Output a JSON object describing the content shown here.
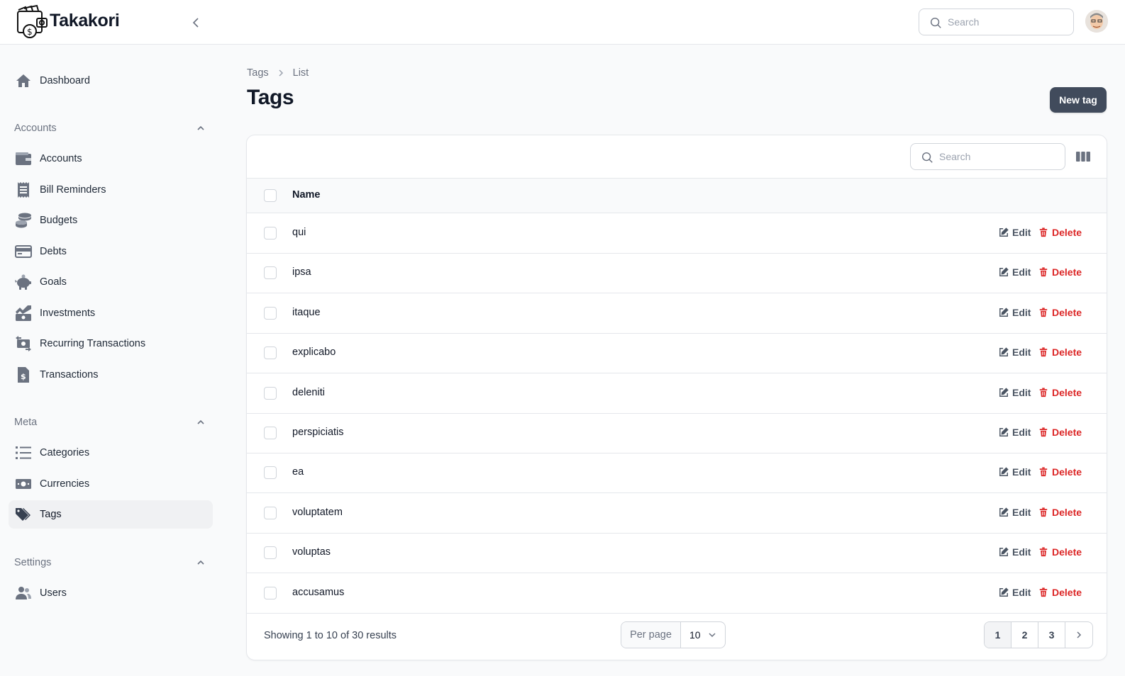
{
  "app": {
    "name": "Takakori"
  },
  "topbar": {
    "search_placeholder": "Search"
  },
  "sidebar": {
    "dashboard": {
      "label": "Dashboard",
      "icon": "home-icon"
    },
    "groups": [
      {
        "label": "Accounts",
        "items": [
          {
            "label": "Accounts",
            "icon": "wallet-icon"
          },
          {
            "label": "Bill Reminders",
            "icon": "receipt-icon"
          },
          {
            "label": "Budgets",
            "icon": "coins-icon"
          },
          {
            "label": "Debts",
            "icon": "credit-card-icon"
          },
          {
            "label": "Goals",
            "icon": "piggy-bank-icon"
          },
          {
            "label": "Investments",
            "icon": "chart-up-icon"
          },
          {
            "label": "Recurring Transactions",
            "icon": "money-refresh-icon"
          },
          {
            "label": "Transactions",
            "icon": "file-dollar-icon"
          }
        ]
      },
      {
        "label": "Meta",
        "items": [
          {
            "label": "Categories",
            "icon": "list-icon"
          },
          {
            "label": "Currencies",
            "icon": "banknote-icon"
          },
          {
            "label": "Tags",
            "icon": "tags-icon",
            "active": true
          }
        ]
      },
      {
        "label": "Settings",
        "items": [
          {
            "label": "Users",
            "icon": "users-icon"
          }
        ]
      }
    ]
  },
  "breadcrumb": [
    "Tags",
    "List"
  ],
  "page": {
    "title": "Tags",
    "new_button": "New tag"
  },
  "table": {
    "search_placeholder": "Search",
    "columns": [
      "Name"
    ],
    "rows": [
      "qui",
      "ipsa",
      "itaque",
      "explicabo",
      "deleniti",
      "perspiciatis",
      "ea",
      "voluptatem",
      "voluptas",
      "accusamus"
    ],
    "actions": {
      "edit": "Edit",
      "delete": "Delete"
    },
    "footer": {
      "showing": "Showing 1 to 10 of 30 results",
      "per_page_label": "Per page",
      "per_page_value": "10",
      "pages": [
        "1",
        "2",
        "3"
      ],
      "current_page": "1"
    }
  },
  "colors": {
    "accent": "#414b5c",
    "danger": "#dc2626",
    "active_nav": "#f0f1f3"
  }
}
